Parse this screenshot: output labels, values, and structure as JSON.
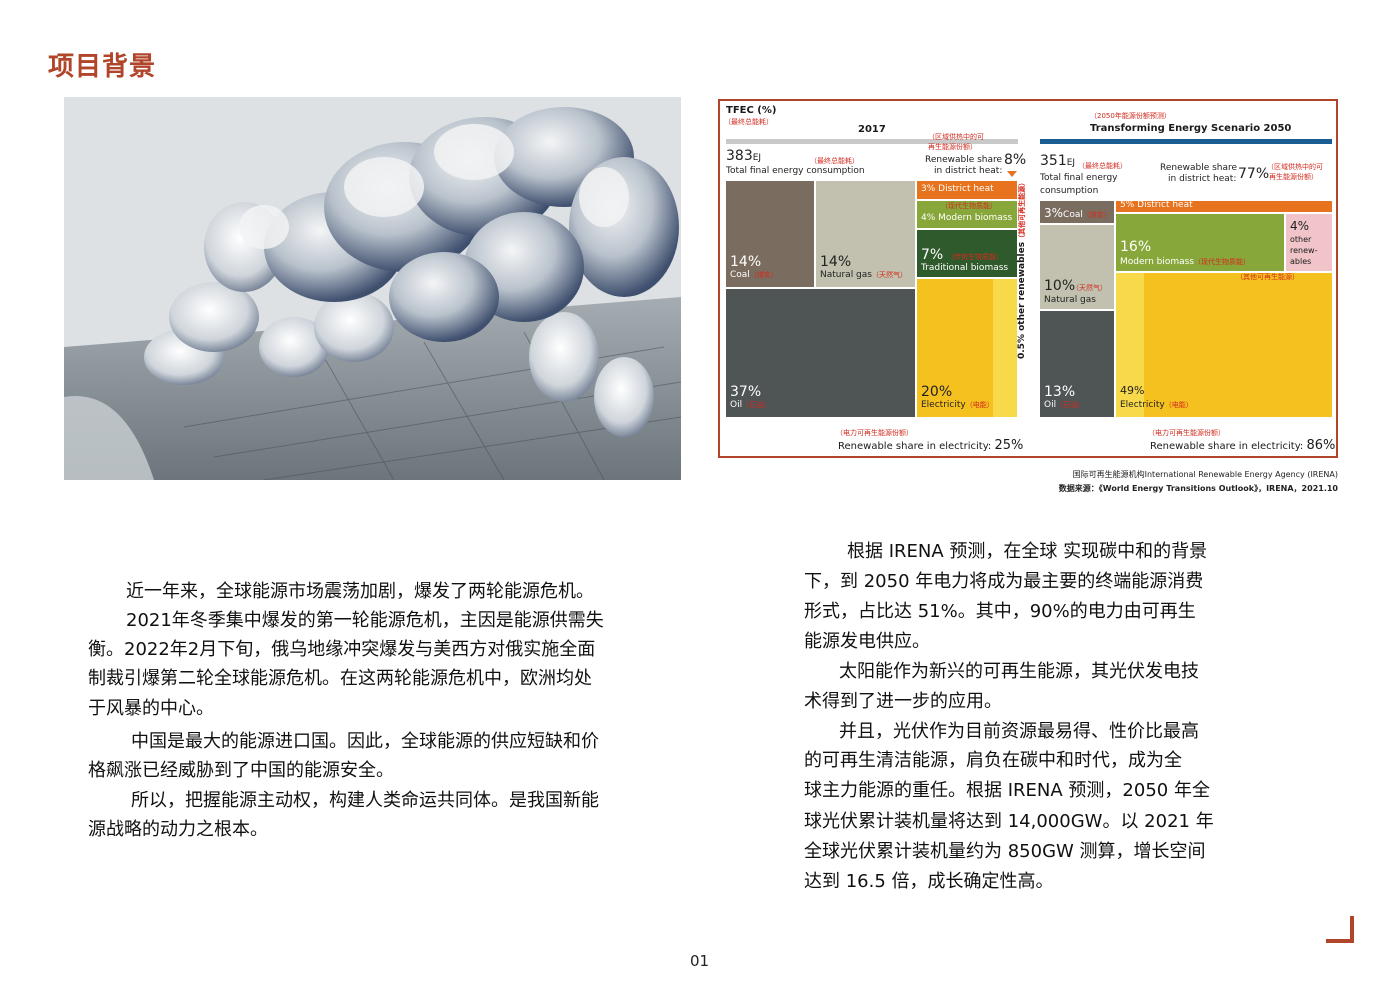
{
  "page_title": "项目背景",
  "chart": {
    "tfec_label": "TFEC (%)",
    "tfec_note": "（最终总能耗）",
    "left": {
      "year": "2017",
      "total_value": "383",
      "total_unit": "EJ",
      "total_note": "（最终总能耗）",
      "total_label": "Total final energy consumption",
      "district_note_1": "（区域供热中的可",
      "district_note_2": "再生能源份额）",
      "district_label_1": "Renewable share",
      "district_label_2": "in district heat:",
      "district_value": "8%",
      "coal_pct": "14%",
      "coal_label": "Coal",
      "coal_note": "（煤炭）",
      "gas_pct": "14%",
      "gas_label": "Natural gas",
      "gas_note": "（天然气）",
      "oil_pct": "37%",
      "oil_label": "Oil",
      "oil_note": "（石油）",
      "heat_pct": "3%",
      "heat_label": "District heat",
      "modern_note": "（现代生物质能）",
      "modern_pct": "4%",
      "modern_label": "Modern biomass",
      "trad_pct": "7%",
      "trad_note": "（传统生物质能）",
      "trad_label": "Traditional biomass",
      "elec_pct": "20%",
      "elec_label": "Electricity",
      "elec_note": "（电能）",
      "elec_share_note": "（电力可再生能源份额）",
      "elec_share_label": "Renewable share in electricity:",
      "elec_share_value": "25%"
    },
    "middle_label": "0.5% other renewables",
    "middle_note": "（其他可再生能源）",
    "right": {
      "scenario_note": "（2050年能源份额预测）",
      "scenario": "Transforming Energy Scenario 2050",
      "total_value": "351",
      "total_unit": "EJ",
      "total_note": "（最终总能耗）",
      "total_label_1": "Total final energy",
      "total_label_2": "consumption",
      "district_label_1": "Renewable share",
      "district_label_2": "in district heat:",
      "district_value": "77%",
      "district_note_1": "（区域供热中的可",
      "district_note_2": "再生能源份额）",
      "coal_pct": "3%",
      "coal_label": "Coal",
      "coal_note": "（煤炭）",
      "heat_pct": "5%",
      "heat_label": "District heat",
      "gas_pct": "10%",
      "gas_note": "（天然气）",
      "gas_label": "Natural gas",
      "modern_pct": "16%",
      "modern_label": "Modern biomass",
      "modern_note": "（现代生物质能）",
      "other_pct": "4%",
      "other_label_1": "other",
      "other_label_2": "renew-",
      "other_label_3": "ables",
      "other_note": "（其他可再生能源）",
      "oil_pct": "13%",
      "oil_label": "Oil",
      "oil_note": "（石油）",
      "elec_pct": "49%",
      "elec_label": "Electricity",
      "elec_note": "（电能）",
      "elec_share_note": "（电力可再生能源份额）",
      "elec_share_label": "Renewable share in electricity:",
      "elec_share_value": "86%"
    }
  },
  "source": {
    "line1": "国际可再生能源机构International Renewable Energy Agency (IRENA)",
    "line2": "数据来源：《World Energy Transitions Outlook》，IRENA，2021.10"
  },
  "left_text": [
    "近一年来，全球能源市场震荡加剧，爆发了两轮能源危机。",
    "2021年冬季集中爆发的第一轮能源危机，主因是能源供需失",
    "衡。2022年2月下旬，俄乌地缘冲突爆发与美西方对俄实施全面",
    "制裁引爆第二轮全球能源危机。在这两轮能源危机中，欧洲均处",
    "于风暴的中心。",
    "中国是最大的能源进口国。因此，全球能源的供应短缺和价",
    "格飙涨已经威胁到了中国的能源安全。",
    "所以，把握能源主动权，构建人类命运共同体。是我国新能",
    "源战略的动力之根本。"
  ],
  "right_text": [
    "根据 IRENA 预测，在全球 实现碳中和的背景",
    "下，到 2050 年电力将成为最主要的终端能源消费",
    "形式，占比达  51%。其中，90%的电力由可再生",
    "能源发电供应。",
    "太阳能作为新兴的可再生能源，其光伏发电技",
    "术得到了进一步的应用。",
    "并且，光伏作为目前资源最易得、性价比最高",
    "的可再生清洁能源，肩负在碳中和时代，成为全",
    "球主力能源的重任。根据 IRENA 预测，2050 年全",
    "球光伏累计装机量将达到 14,000GW。以 2021 年",
    "全球光伏累计装机量约为 850GW 测算，增长空间",
    "达到 16.5 倍，成长确定性高。"
  ],
  "page_number": "01",
  "colors": {
    "accent": "#b0452a",
    "note_red": "#d42a1e",
    "coal": "#7a6d5f",
    "gas": "#c2c0ae",
    "oil": "#4f5455",
    "heat": "#e8731e",
    "modern": "#88a73a",
    "traditional": "#2f5b2c",
    "electricity": "#f5c11f",
    "other": "#f0c4c8",
    "scenario_bar": "#1a5d93"
  }
}
